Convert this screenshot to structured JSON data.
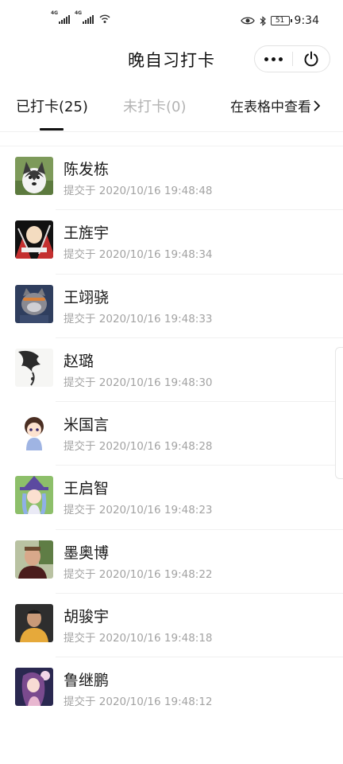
{
  "status_bar": {
    "network_1": "4G",
    "network_2": "4G",
    "time": "9:34",
    "battery": "51"
  },
  "header": {
    "title": "晚自习打卡"
  },
  "tabs": {
    "checked": "已打卡(25)",
    "unchecked": "未打卡(0)",
    "sheet_view": "在表格中查看"
  },
  "records": [
    {
      "name": "陈发栋",
      "time": "提交于 2020/10/16 19:48:48",
      "avatar": "husky-photo"
    },
    {
      "name": "王旌宇",
      "time": "提交于 2020/10/16 19:48:34",
      "avatar": "bald-hero-anime"
    },
    {
      "name": "王翊骁",
      "time": "提交于 2020/10/16 19:48:33",
      "avatar": "cartoon-wolf"
    },
    {
      "name": "赵璐",
      "time": "提交于 2020/10/16 19:48:30",
      "avatar": "ink-painting"
    },
    {
      "name": "米国言",
      "time": "提交于 2020/10/16 19:48:28",
      "avatar": "chibi-boy"
    },
    {
      "name": "王启智",
      "time": "提交于 2020/10/16 19:48:23",
      "avatar": "witch-anime-girl"
    },
    {
      "name": "墨奥博",
      "time": "提交于 2020/10/16 19:48:22",
      "avatar": "man-photo"
    },
    {
      "name": "胡骏宇",
      "time": "提交于 2020/10/16 19:48:18",
      "avatar": "young-man-photo"
    },
    {
      "name": "鲁继鹏",
      "time": "提交于 2020/10/16 19:48:12",
      "avatar": "anime-girl-night"
    }
  ],
  "colors": {
    "text_primary": "#1a1a1a",
    "text_secondary": "#a3a3a3",
    "tab_inactive": "#b3b3b3",
    "divider": "#f0f0f0"
  }
}
